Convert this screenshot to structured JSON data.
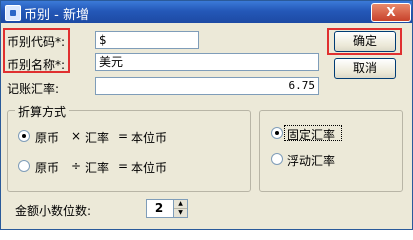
{
  "window": {
    "title": "币别 - 新增",
    "close_label": "X"
  },
  "form": {
    "code_label": "币别代码*:",
    "code_value": "$",
    "name_label": "币别名称*:",
    "name_value": "美元",
    "rate_label": "记账汇率:",
    "rate_value": "6.75",
    "highlight_color": "#e03030"
  },
  "buttons": {
    "ok": "确定",
    "cancel": "取消"
  },
  "conversion": {
    "group_title": "折算方式",
    "multiply": {
      "a": "原币",
      "op": "×",
      "b": "汇率",
      "eq": "=",
      "c": "本位币",
      "selected": true
    },
    "divide": {
      "a": "原币",
      "op": "÷",
      "b": "汇率",
      "eq": "=",
      "c": "本位币",
      "selected": false
    }
  },
  "rate_type": {
    "fixed": "固定汇率",
    "floating": "浮动汇率",
    "selected": "fixed"
  },
  "decimals": {
    "label": "金额小数位数:",
    "value": "2"
  }
}
